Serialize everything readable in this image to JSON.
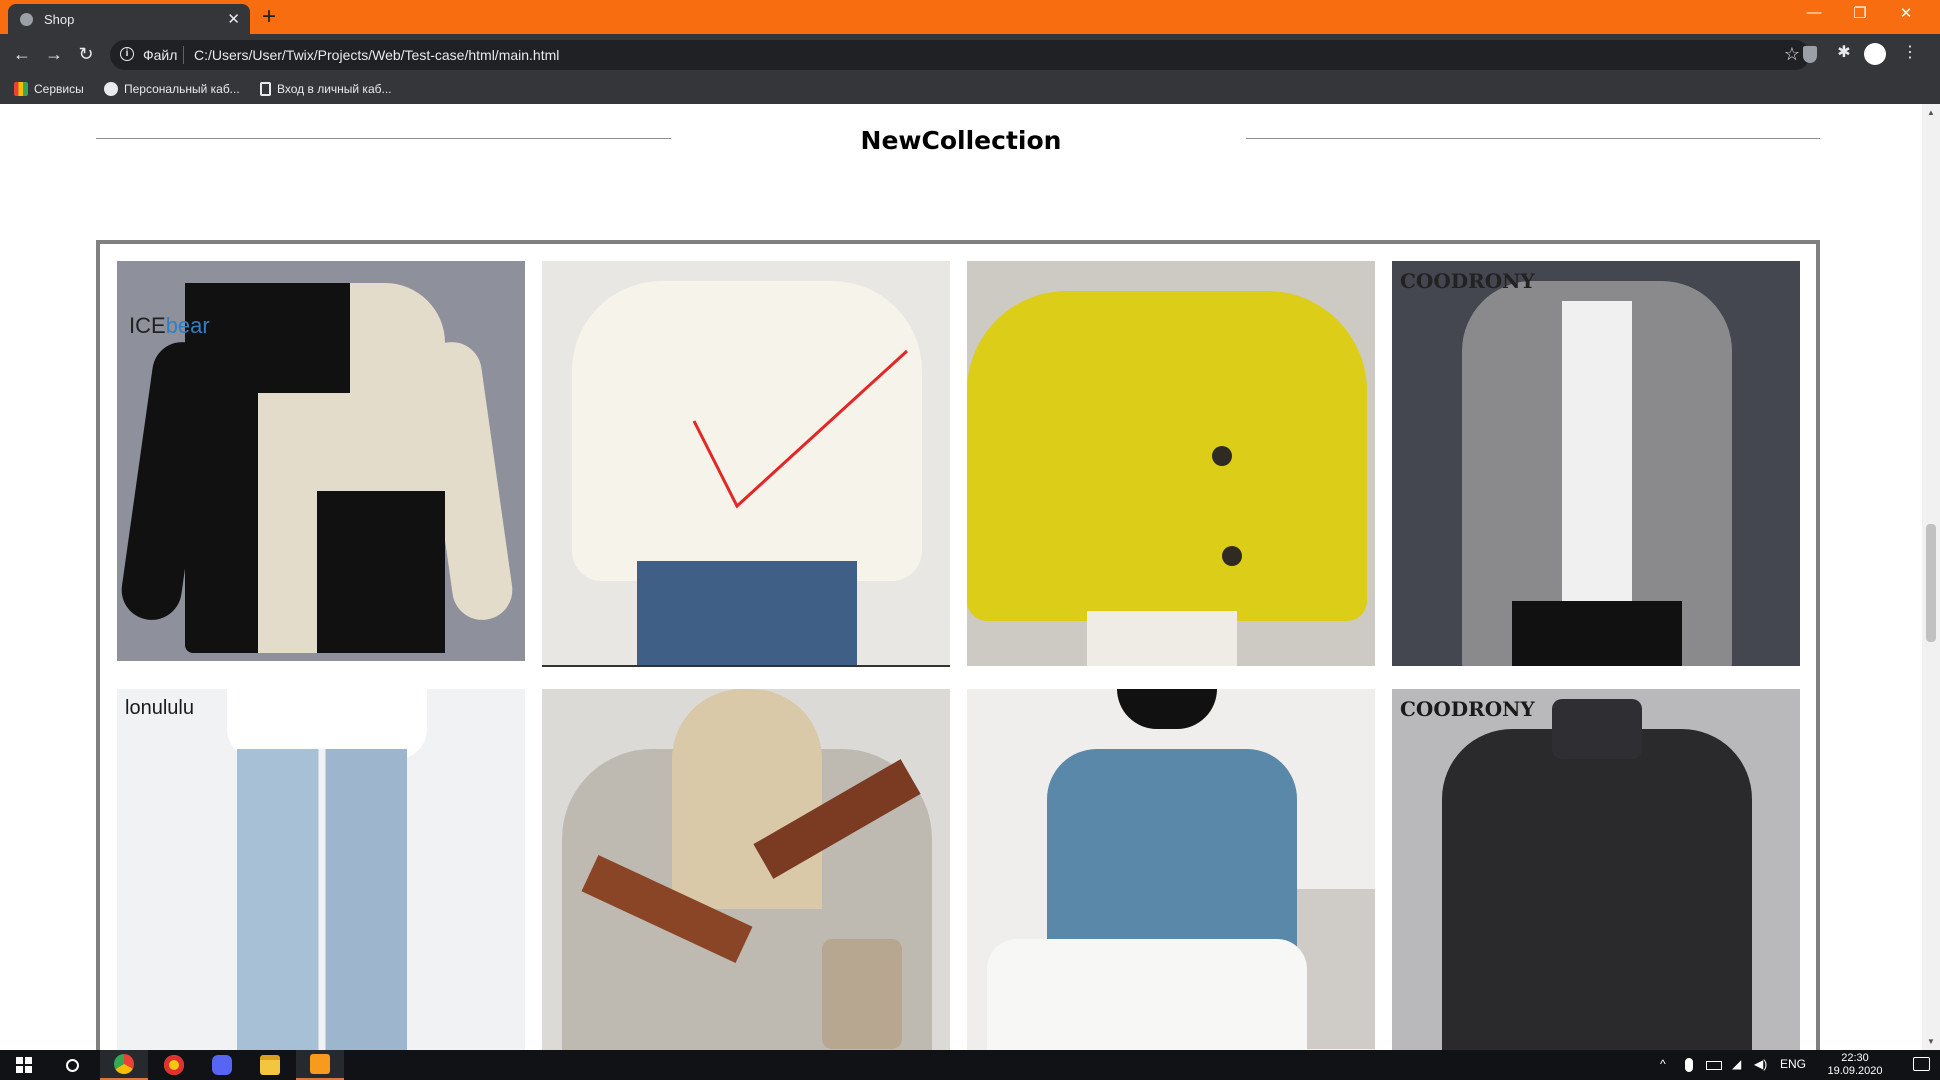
{
  "browser": {
    "tab_title": "Shop",
    "tab_close": "✕",
    "new_tab": "+",
    "window_controls": {
      "minimize": "—",
      "restore": "❐",
      "close": "✕"
    },
    "nav": {
      "back": "←",
      "forward": "→",
      "reload": "↻"
    },
    "address": {
      "info_icon": "i",
      "scheme_label": "Файл",
      "url": "C:/Users/User/Twix/Projects/Web/Test-case/html/main.html",
      "star": "☆"
    },
    "extensions": {
      "puzzle": "✱",
      "menu": "⋮"
    },
    "bookmarks": [
      {
        "label": "Сервисы",
        "icon": "apps-icon"
      },
      {
        "label": "Персональный каб...",
        "icon": "globe-icon"
      },
      {
        "label": "Вход в личный каб...",
        "icon": "document-icon"
      }
    ]
  },
  "page": {
    "section_title": "NewCollection",
    "products": [
      {
        "brand": "ICEbear",
        "brand_a": "ICE",
        "brand_b": "bear",
        "image": "black-beige-sweater"
      },
      {
        "brand": "",
        "image": "white-knit-cardigan"
      },
      {
        "brand": "",
        "image": "yellow-knit-cardigan"
      },
      {
        "brand": "COODRONY",
        "image": "grey-hooded-cardigan"
      },
      {
        "brand": "lonululu",
        "image": "light-blue-jeans"
      },
      {
        "brand": "",
        "image": "striped-knit-sweater"
      },
      {
        "brand": "",
        "image": "blue-tshirt"
      },
      {
        "brand": "COODRONY",
        "image": "black-turtleneck-sweater"
      }
    ],
    "colors": {
      "rule": "#8f8f8f",
      "frame": "#808080",
      "accent_check": "#e32626"
    }
  },
  "taskbar": {
    "apps": [
      "windows-start-icon",
      "search-icon",
      "chrome-icon",
      "yandex-icon",
      "discord-icon",
      "file-explorer-icon",
      "sublime-text-icon"
    ],
    "tray": {
      "chevron": "^",
      "language": "ENG"
    },
    "time": "22:30",
    "date": "19.09.2020"
  }
}
